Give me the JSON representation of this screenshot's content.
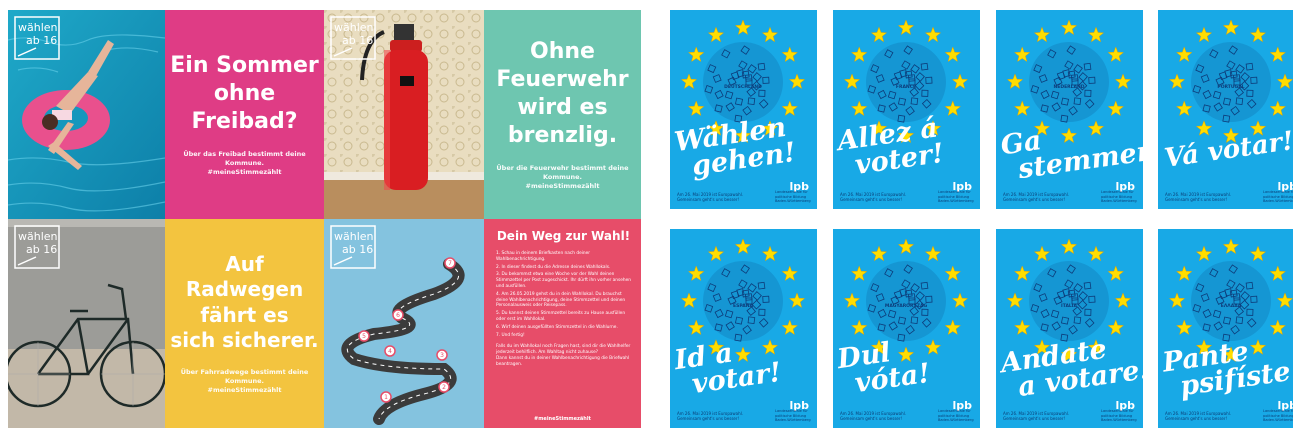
{
  "left_collage": {
    "logo_text": [
      "wählen",
      "ab 16"
    ],
    "panels": {
      "freibad": {
        "headline": [
          "Ein Sommer",
          "ohne",
          "Freibad?"
        ],
        "small": [
          "Über das Freibad bestimmt deine Kommune.",
          "#meineStimmezählt"
        ],
        "color": "#df3c85"
      },
      "feuerwehr": {
        "headline": [
          "Ohne",
          "Feuerwehr",
          "wird es",
          "brenzlig."
        ],
        "small": [
          "Über die Feuerwehr bestimmt deine Kommune.",
          "#meineStimmezählt"
        ],
        "color": "#6ec6b0"
      },
      "radwege": {
        "headline": [
          "Auf Radwegen",
          "fährt es",
          "sich sicherer."
        ],
        "small": [
          "Über Fahrradwege bestimmt deine Kommune.",
          "#meineStimmezählt"
        ],
        "color": "#f3c43f"
      },
      "weg": {
        "title": "Dein Weg zur Wahl!",
        "color": "#e74d69",
        "steps": [
          "1. Schau in deinem Briefkasten nach deiner Wahlbenachrichtigung.",
          "2. In dieser findest du die Adresse deines Wahllokals.",
          "3. Du bekommst etwa eine Woche vor der Wahl deinen Stimmzettel per Post zugeschickt. Ihr dürft ihn vorher ansehen und ausfüllen.",
          "4. Am 26.05.2019 gehst du in dein Wahllokal. Du brauchst deine Wahlbenachrichtigung, deine Stimmzettel und deinen Personalausweis oder Reisepass.",
          "5. Du kannst deinen Stimmzettel bereits zu Hause ausfüllen oder erst im Wahllokal.",
          "6. Wirf deinen ausgefüllten Stimmzettel in die Wahlurne.",
          "7. Und fertig!"
        ],
        "footer": [
          "Falls du im Wahllokal noch Fragen hast, sind dir die Wahlhelfer jederzeit behilflich. Am Wahltag nicht zuhause?",
          "Dann kannst du in deiner Wahlbenachrichtigung die Briefwahl beantragen."
        ],
        "hashtag": "#meineStimmezählt",
        "road_markers": [
          "7",
          "6",
          "5",
          "4",
          "3",
          "2",
          "1"
        ]
      }
    }
  },
  "posters": [
    {
      "slogan": [
        "Wählen",
        "gehen!"
      ],
      "country": "DEUTSCHLAND"
    },
    {
      "slogan": [
        "Allez á",
        "voter!"
      ],
      "country": "FRANCE"
    },
    {
      "slogan": [
        "Ga",
        "stemmen!"
      ],
      "country": "NEDERLAND"
    },
    {
      "slogan": [
        "Vá votar!"
      ],
      "country": "PORTUGAL"
    },
    {
      "slogan": [
        "Id a",
        "votar!"
      ],
      "country": "ESPAÑA"
    },
    {
      "slogan": [
        "Dul",
        "vóta!"
      ],
      "country": "MAGYARORSZÁG"
    },
    {
      "slogan": [
        "Andate",
        "a votare!"
      ],
      "country": "ITALIA"
    },
    {
      "slogan": [
        "Pante",
        "psifíste!"
      ],
      "country": "ΕΛΛΑΔΑ"
    }
  ],
  "poster_footer": [
    "Am 26. Mai 2019 ist Europawahl.",
    "Gemeinsam geht's uns besser!"
  ],
  "poster_logo": "lpb",
  "poster_logo_sub": "Landeszentrale für politische Bildung Baden-Württemberg",
  "colors": {
    "poster_blue": "#18a9e6",
    "star": "#ffdd00",
    "icon": "#0d3c7a"
  }
}
